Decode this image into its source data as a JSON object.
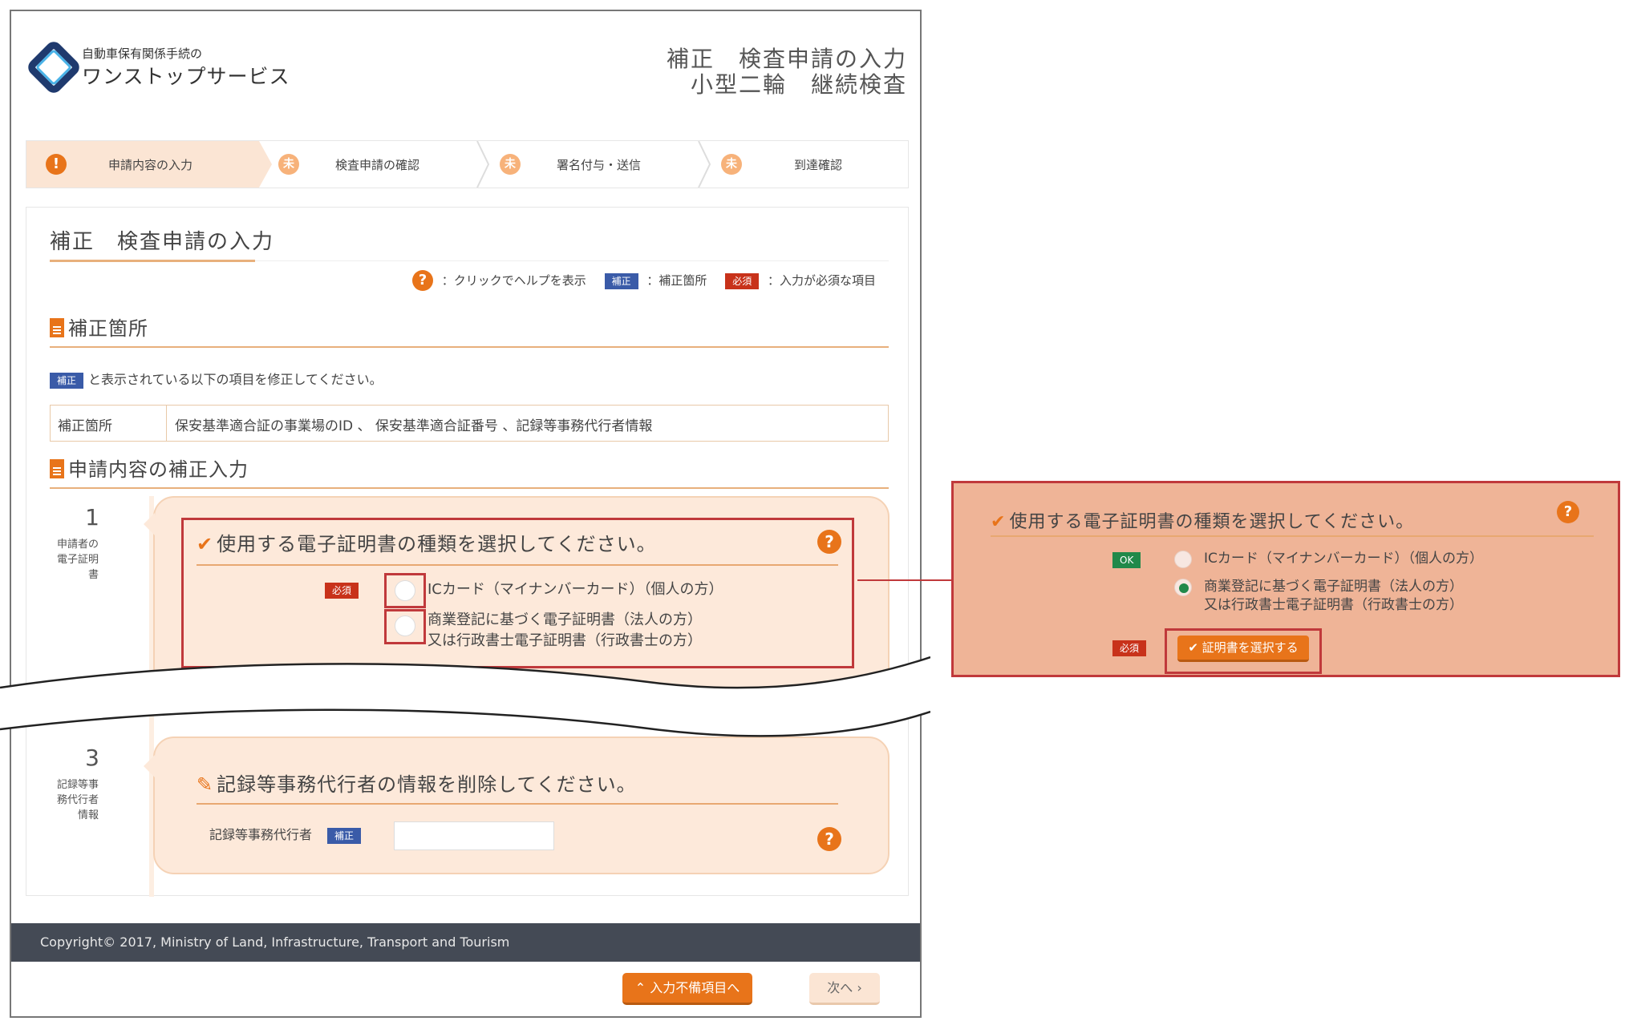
{
  "header": {
    "logo_small": "自動車保有関係手続の",
    "logo_big": "ワンストップサービス",
    "title_line1": "補正　検査申請の入力",
    "title_line2": "小型二輪　継続検査"
  },
  "steps": [
    {
      "label": "申請内容の入力",
      "mark": "!"
    },
    {
      "label": "検査申請の確認",
      "mark": "未"
    },
    {
      "label": "署名付与・送信",
      "mark": "未"
    },
    {
      "label": "到達確認",
      "mark": "未"
    }
  ],
  "panel": {
    "title": "補正　検査申請の入力",
    "legend": {
      "help_icon": "?",
      "help_text": "：クリックでヘルプを表示",
      "fix_badge": "補正",
      "fix_text": "：補正箇所",
      "req_badge": "必須",
      "req_text": "：入力が必須な項目"
    },
    "section1": "補正箇所",
    "note_badge": "補正",
    "note_text": "と表示されている以下の項目を修正してください。",
    "table_header": "補正箇所",
    "table_value": "保安基準適合証の事業場のID 、 保安基準適合証番号 、記録等事務代行者情報",
    "section2": "申請内容の補正入力"
  },
  "item1": {
    "number": "1",
    "label_lines": [
      "申請者の",
      "電子証明",
      "書"
    ],
    "question": "使用する電子証明書の種類を選択してください。",
    "required_badge": "必須",
    "option1": "ICカード（マイナンバーカード）（個人の方）",
    "option2_line1": "商業登記に基づく電子証明書（法人の方）",
    "option2_line2": "又は行政書士電子証明書（行政書士の方）"
  },
  "item3": {
    "number": "3",
    "label_lines": [
      "記録等事",
      "務代行者",
      "情報"
    ],
    "question": "記録等事務代行者の情報を削除してください。",
    "field_label": "記録等事務代行者",
    "fix_badge": "補正",
    "field_value": ""
  },
  "footer": {
    "copyright": "Copyright© 2017, Ministry of Land, Infrastructure, Transport and Tourism",
    "incomplete_button": "入力不備項目へ",
    "next_button": "次へ"
  },
  "zoom": {
    "question": "使用する電子証明書の種類を選択してください。",
    "ok_badge": "OK",
    "option1": "ICカード（マイナンバーカード）（個人の方）",
    "option2_line1": "商業登記に基づく電子証明書（法人の方）",
    "option2_line2": "又は行政書士電子証明書（行政書士の方）",
    "required_badge": "必須",
    "select_button": "証明書を選択する",
    "selected_option": 2
  },
  "colors": {
    "accent": "#e8741a",
    "highlight": "#c0393b",
    "fix_badge": "#3a5ba8",
    "required_badge": "#c8321a",
    "ok_badge": "#21894a"
  }
}
